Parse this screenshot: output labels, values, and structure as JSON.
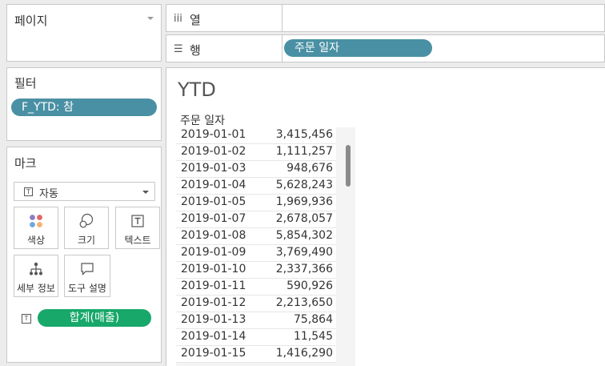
{
  "pages": {
    "title": "페이지"
  },
  "filters": {
    "title": "필터",
    "pill": "F_YTD: 참"
  },
  "marks": {
    "title": "마크",
    "type": "자동",
    "buttons": {
      "color": "색상",
      "size": "크기",
      "label": "텍스트",
      "detail": "세부 정보",
      "tooltip": "도구 설명"
    },
    "measure_pill": "합계(매출)"
  },
  "columns_shelf": {
    "label": "열"
  },
  "rows_shelf": {
    "label": "행",
    "pill": "주문 일자"
  },
  "sheet": {
    "title": "YTD",
    "column_header": "주문 일자",
    "rows": [
      {
        "date": "2019-01-01",
        "value": "3,415,456"
      },
      {
        "date": "2019-01-02",
        "value": "1,111,257"
      },
      {
        "date": "2019-01-03",
        "value": "948,676"
      },
      {
        "date": "2019-01-04",
        "value": "5,628,243"
      },
      {
        "date": "2019-01-05",
        "value": "1,969,936"
      },
      {
        "date": "2019-01-07",
        "value": "2,678,057"
      },
      {
        "date": "2019-01-08",
        "value": "5,854,302"
      },
      {
        "date": "2019-01-09",
        "value": "3,769,490"
      },
      {
        "date": "2019-01-10",
        "value": "2,337,366"
      },
      {
        "date": "2019-01-11",
        "value": "590,926"
      },
      {
        "date": "2019-01-12",
        "value": "2,213,650"
      },
      {
        "date": "2019-01-13",
        "value": "75,864"
      },
      {
        "date": "2019-01-14",
        "value": "11,545"
      },
      {
        "date": "2019-01-15",
        "value": "1,416,290"
      }
    ]
  },
  "colors": {
    "dimension_pill": "#4a90a4",
    "measure_pill": "#17a86a"
  }
}
